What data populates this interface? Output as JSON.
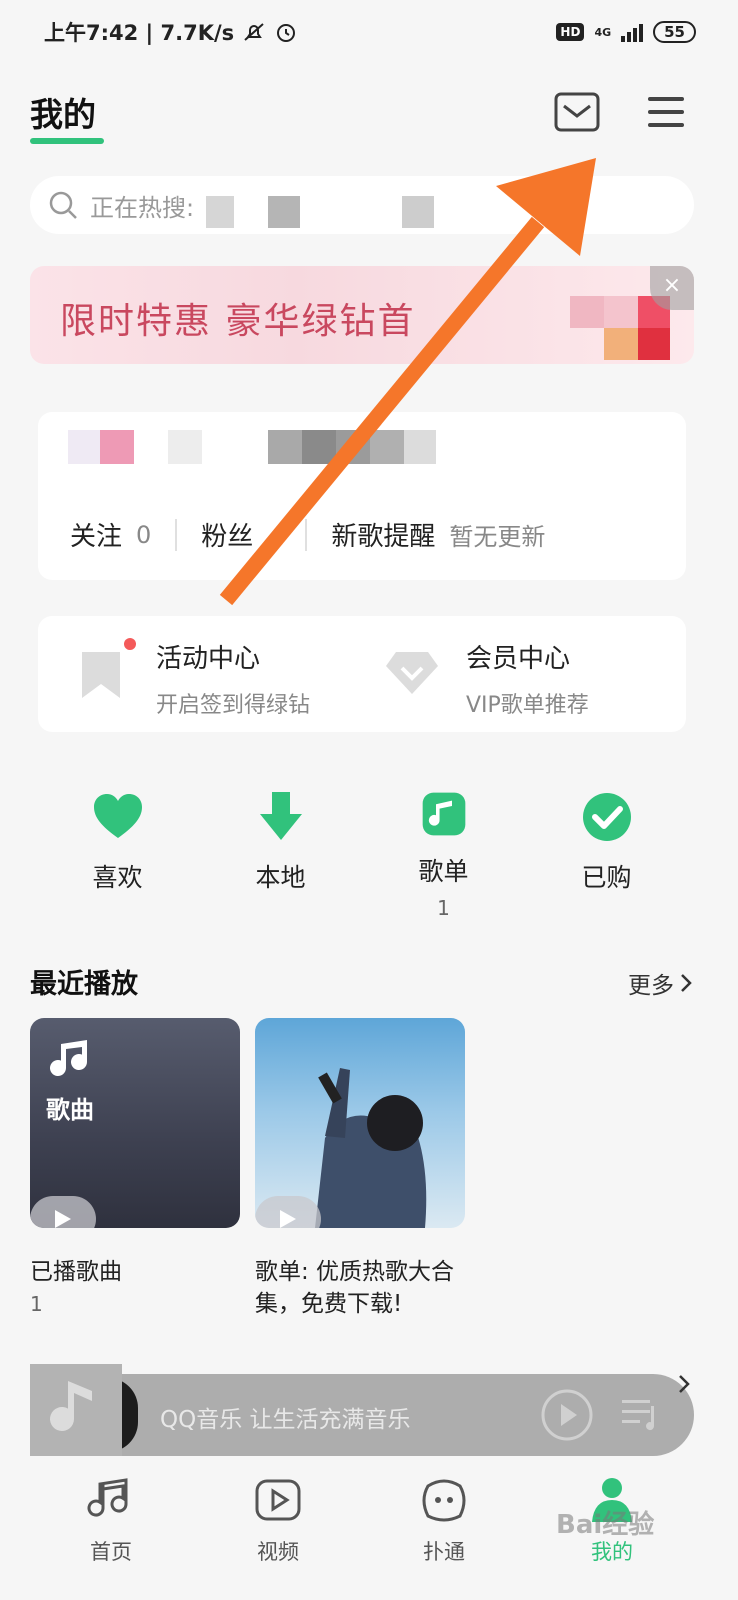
{
  "status_bar": {
    "time": "上午7:42 | 7.7K/s",
    "hd": "HD",
    "network": "4G",
    "battery": "55"
  },
  "header": {
    "title": "我的"
  },
  "search": {
    "placeholder": "正在热搜:"
  },
  "promo": {
    "text": "限时特惠 豪华绿钻首",
    "close": "×"
  },
  "profile": {
    "follow_label": "关注",
    "follow_value": "0",
    "fans_label": "粉丝",
    "new_songs_label": "新歌提醒",
    "new_songs_note": "暂无更新"
  },
  "centers": {
    "activity_title": "活动中心",
    "activity_sub": "开启签到得绿钻",
    "vip_title": "会员中心",
    "vip_sub": "VIP歌单推荐"
  },
  "quick": [
    {
      "label": "喜欢",
      "icon": "heart-icon"
    },
    {
      "label": "本地",
      "icon": "download-icon"
    },
    {
      "label": "歌单",
      "icon": "music-note-icon",
      "count": "1"
    },
    {
      "label": "已购",
      "icon": "check-icon"
    }
  ],
  "recent": {
    "title": "最近播放",
    "more": "更多",
    "items": [
      {
        "cover_label": "歌曲",
        "title": "已播歌曲",
        "count": "1"
      },
      {
        "title": "歌单: 优质热歌大合集，免费下载!"
      }
    ]
  },
  "mini_player": {
    "text": "QQ音乐 让生活充满音乐"
  },
  "tabs": [
    {
      "label": "首页",
      "icon": "music-note-icon"
    },
    {
      "label": "视频",
      "icon": "video-icon"
    },
    {
      "label": "扑通",
      "icon": "face-icon"
    },
    {
      "label": "我的",
      "icon": "profile-icon",
      "active": true
    }
  ],
  "watermark": "Bai经验",
  "colors": {
    "accent": "#31c27c",
    "annotation_arrow": "#f5762a",
    "notification_dot": "#f45a5a"
  }
}
